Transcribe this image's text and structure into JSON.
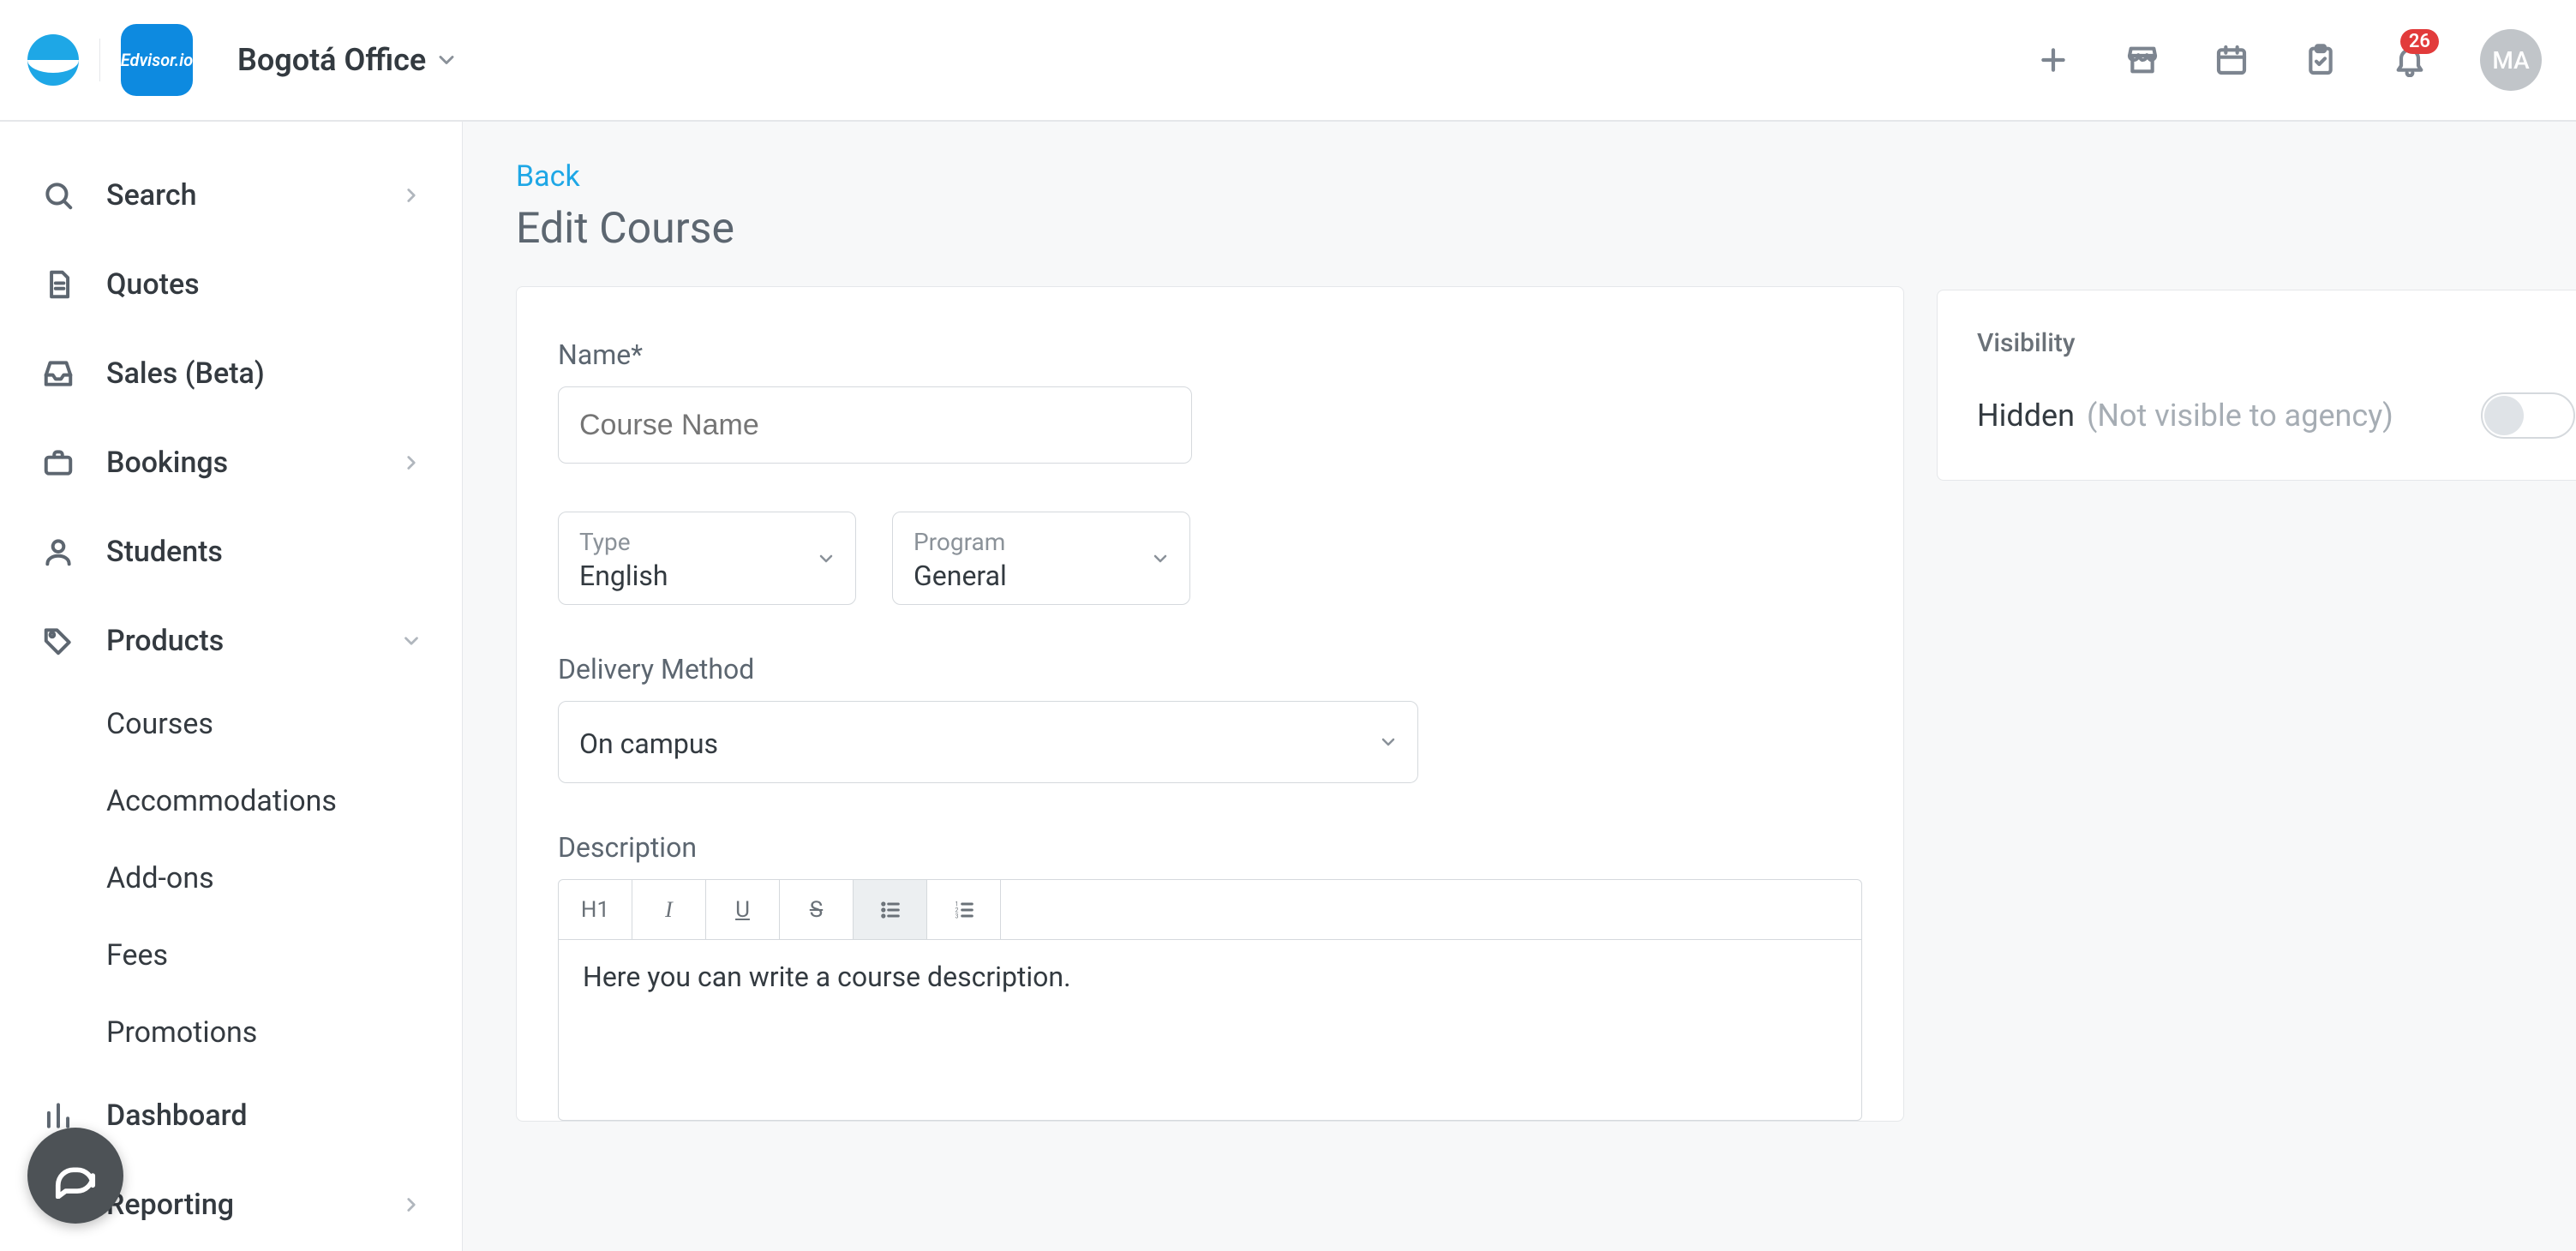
{
  "header": {
    "brand_text": "Edvisor.io",
    "office_name": "Bogotá Office",
    "notification_count": "26",
    "avatar_initials": "MA"
  },
  "sidebar": {
    "items": [
      {
        "label": "Search",
        "icon": "search-icon",
        "chev": "right"
      },
      {
        "label": "Quotes",
        "icon": "document-icon",
        "chev": ""
      },
      {
        "label": "Sales (Beta)",
        "icon": "inbox-icon",
        "chev": ""
      },
      {
        "label": "Bookings",
        "icon": "briefcase-icon",
        "chev": "right"
      },
      {
        "label": "Students",
        "icon": "person-icon",
        "chev": ""
      },
      {
        "label": "Products",
        "icon": "tag-icon",
        "chev": "down"
      },
      {
        "label": "Dashboard",
        "icon": "bars-icon",
        "chev": ""
      },
      {
        "label": "Reporting",
        "icon": "",
        "chev": "right"
      }
    ],
    "products_sub": [
      "Courses",
      "Accommodations",
      "Add-ons",
      "Fees",
      "Promotions"
    ]
  },
  "page": {
    "back_label": "Back",
    "title": "Edit Course"
  },
  "form": {
    "name_label": "Name*",
    "name_placeholder": "Course Name",
    "type_label": "Type",
    "type_value": "English",
    "program_label": "Program",
    "program_value": "General",
    "delivery_label": "Delivery Method",
    "delivery_value": "On campus",
    "description_label": "Description",
    "editor_buttons": [
      "H1",
      "I",
      "U",
      "S",
      "bullet",
      "numbered"
    ],
    "editor_text": "Here you can write a course description."
  },
  "visibility": {
    "title": "Visibility",
    "label": "Hidden",
    "hint": "(Not visible to agency)"
  }
}
